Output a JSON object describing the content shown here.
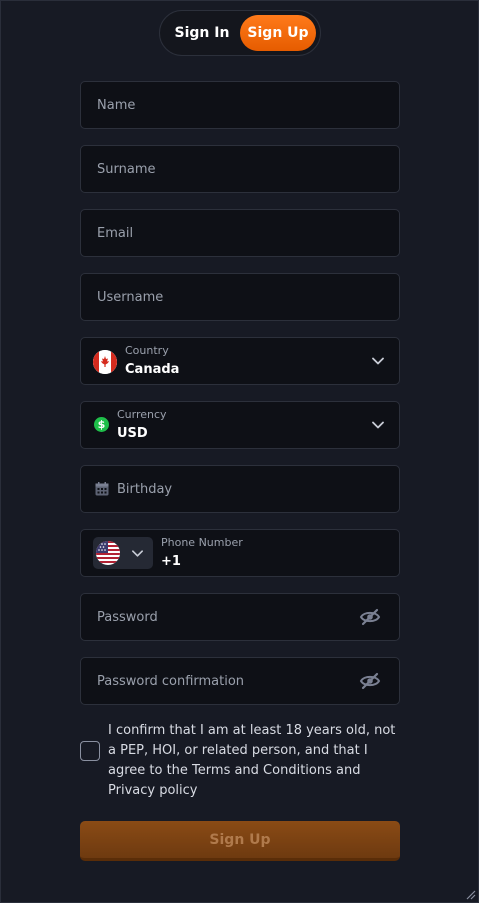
{
  "tabs": {
    "signin_label": "Sign In",
    "signup_label": "Sign Up",
    "active": "Sign Up"
  },
  "fields": {
    "name_placeholder": "Name",
    "surname_placeholder": "Surname",
    "email_placeholder": "Email",
    "username_placeholder": "Username",
    "country": {
      "label": "Country",
      "value": "Canada",
      "flag_icon": "canada-flag-icon"
    },
    "currency": {
      "label": "Currency",
      "value": "USD",
      "icon": "dollar-icon"
    },
    "birthday_placeholder": "Birthday",
    "phone": {
      "label": "Phone Number",
      "value": "+1",
      "flag_icon": "us-flag-icon"
    },
    "password_placeholder": "Password",
    "password_confirmation_placeholder": "Password confirmation"
  },
  "consent": {
    "text": "I confirm that I am at least 18 years old, not a PEP, HOI, or related person, and that I agree to the Terms and Conditions and Privacy policy",
    "checked": false
  },
  "submit_label": "Sign Up",
  "colors": {
    "accent": "#ff7a1a",
    "background": "#171a24",
    "field_background": "#0e1016"
  }
}
